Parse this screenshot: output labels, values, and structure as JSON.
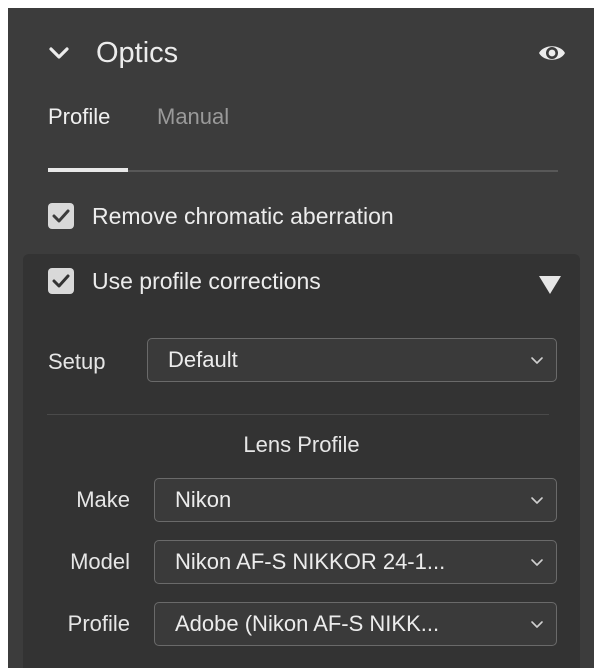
{
  "panel": {
    "title": "Optics",
    "icons": {
      "collapse": "chevron-down-icon",
      "visibility": "eye-icon"
    }
  },
  "tabs": [
    {
      "label": "Profile",
      "active": true
    },
    {
      "label": "Manual",
      "active": false
    }
  ],
  "options": {
    "remove_ca": {
      "label": "Remove chromatic aberration",
      "checked": true
    },
    "profile_corrections": {
      "label": "Use profile corrections",
      "checked": true,
      "expanded": true
    }
  },
  "setup": {
    "label": "Setup",
    "value": "Default"
  },
  "lens_profile": {
    "title": "Lens Profile",
    "make": {
      "label": "Make",
      "value": "Nikon"
    },
    "model": {
      "label": "Model",
      "value": "Nikon AF-S NIKKOR 24-1..."
    },
    "profile": {
      "label": "Profile",
      "value": "Adobe (Nikon AF-S NIKK..."
    }
  },
  "colors": {
    "panel_bg": "#3c3c3c",
    "subpanel_bg": "#333333",
    "text": "#ececec",
    "muted_text": "#9a9a9a",
    "checkbox": "#d9d9d9",
    "field_border": "#6a6a6a"
  }
}
